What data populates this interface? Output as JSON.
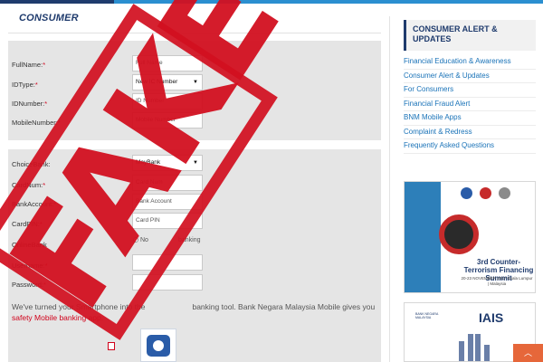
{
  "section": {
    "title": "CONSUMER"
  },
  "personal_form": {
    "rows": [
      {
        "label": "FullName:",
        "placeholder": "Full Name"
      },
      {
        "label": "IDType:",
        "value": "New IC Number"
      },
      {
        "label": "IDNumber:",
        "placeholder": "ID Number"
      },
      {
        "label": "MobileNumber:",
        "placeholder": "Mobile Number"
      }
    ]
  },
  "banking_form": {
    "choice_bank": {
      "label": "ChoiceBank:",
      "value": "MayBank"
    },
    "card_num": {
      "label": "CardNum:",
      "placeholder": "Card Num"
    },
    "bank_account": {
      "label": "BankAccount:",
      "placeholder": "Bank Account"
    },
    "card_pin": {
      "label": "CardPIN:",
      "placeholder": "Card PIN"
    },
    "online_bank": {
      "label": "OnlineBank",
      "option_visible": "No",
      "option_visible_2": "banking"
    },
    "username": {
      "label": "Username:"
    },
    "password": {
      "label": "Password:"
    },
    "required_mark": "*"
  },
  "banner": {
    "line_start": "We've turned your Smartphone into the",
    "line_end": "banking tool. Bank Negara Malaysia Mobile gives you",
    "highlight": "safety Mobile banking app."
  },
  "stamp": {
    "text": "FAKE",
    "color": "#d21020"
  },
  "sidebar": {
    "alert_title": "CONSUMER ALERT & UPDATES",
    "links": [
      "Financial Education & Awareness",
      "Consumer Alert & Updates",
      "For Consumers",
      "Financial Fraud Alert",
      "BNM Mobile Apps",
      "Complaint & Redress",
      "Frequently Asked Questions"
    ]
  },
  "ads": {
    "summit": {
      "title": "3rd Counter-Terrorism Financing Summit",
      "date": "20-23 NOVEMBER 2017 Kuala Lumpur | Malaysia"
    },
    "iais": {
      "logo_text": "IAIS",
      "bnm_text": "BANK NEGARA MALAYSIA"
    }
  },
  "colors": {
    "brand_navy": "#1f3b6d",
    "accent_blue": "#2b8fd0",
    "link_blue": "#1a73b8",
    "required_red": "#d0021b",
    "scroll_orange": "#e6673a"
  },
  "icons": {
    "scroll_top": "chevron-up-icon",
    "app": "bnm-app-icon"
  }
}
